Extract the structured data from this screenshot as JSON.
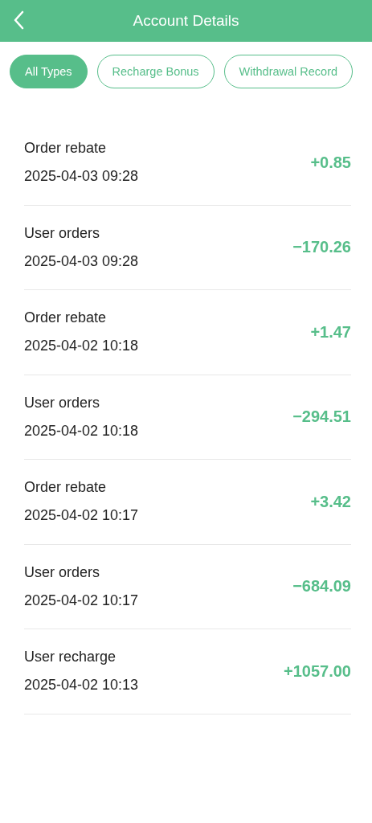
{
  "header": {
    "title": "Account Details"
  },
  "filters": [
    {
      "label": "All Types",
      "selected": true
    },
    {
      "label": "Recharge Bonus",
      "selected": false
    },
    {
      "label": "Withdrawal Record",
      "selected": false
    }
  ],
  "records": [
    {
      "type": "Order rebate",
      "time": "2025-04-03 09:28",
      "amount": "+0.85"
    },
    {
      "type": "User orders",
      "time": "2025-04-03 09:28",
      "amount": "−170.26"
    },
    {
      "type": "Order rebate",
      "time": "2025-04-02 10:18",
      "amount": "+1.47"
    },
    {
      "type": "User orders",
      "time": "2025-04-02 10:18",
      "amount": "−294.51"
    },
    {
      "type": "Order rebate",
      "time": "2025-04-02 10:17",
      "amount": "+3.42"
    },
    {
      "type": "User orders",
      "time": "2025-04-02 10:17",
      "amount": "−684.09"
    },
    {
      "type": "User recharge",
      "time": "2025-04-02 10:13",
      "amount": "+1057.00"
    }
  ]
}
